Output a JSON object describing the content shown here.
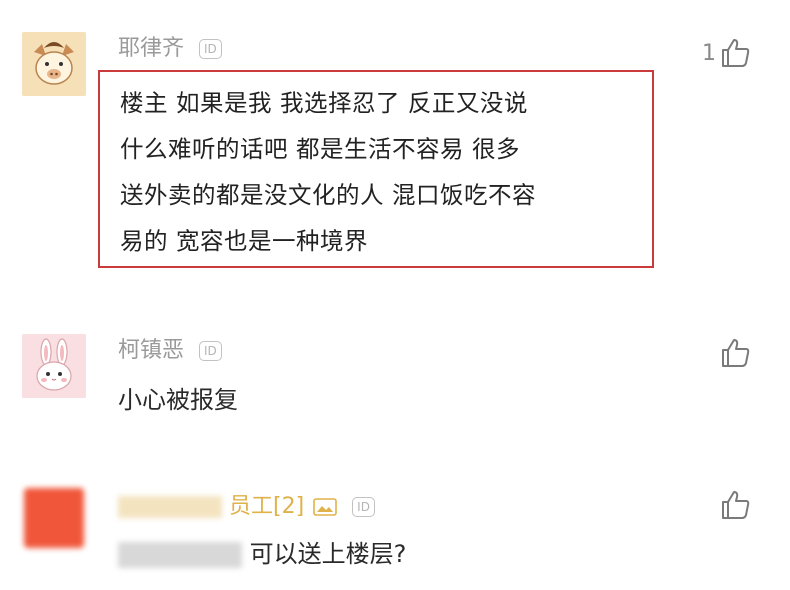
{
  "comments": [
    {
      "username": "耶律齐",
      "id_badge": "ID",
      "likes": "1",
      "lines": [
        "楼主 如果是我  我选择忍了  反正又没说",
        "什么难听的话吧  都是生活不容易  很多",
        "送外卖的都是没文化的人 混口饭吃不容",
        "易的  宽容也是一种境界"
      ]
    },
    {
      "username": "柯镇恶",
      "id_badge": "ID",
      "text": "小心被报复"
    },
    {
      "username_visible": "员工[2]",
      "id_badge": "ID",
      "text_visible": "可以送上楼层?"
    }
  ],
  "colors": {
    "highlight_border": "#cc3b3b",
    "meta_text": "#9a9a9a",
    "body_text": "#2a2a2a",
    "avatar_pig_bg": "#f6e0b8",
    "avatar_rabbit_bg": "#f9dfe2",
    "avatar_orange": "#f0563a"
  },
  "icons": [
    "thumbs-up-icon",
    "pig-avatar",
    "rabbit-avatar",
    "image-badge-icon"
  ]
}
